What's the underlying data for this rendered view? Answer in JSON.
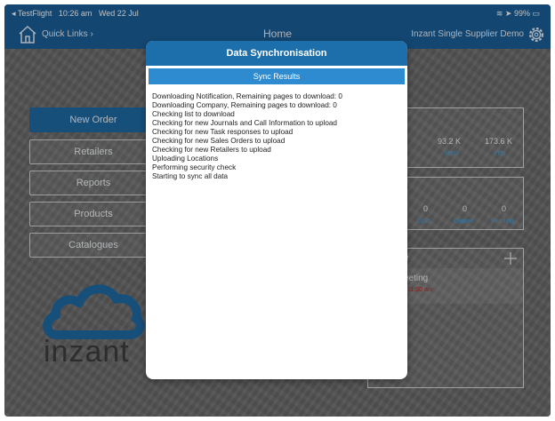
{
  "status_bar": {
    "carrier": "◂ TestFlight",
    "time": "10:26 am",
    "date": "Wed 22 Jul",
    "battery": "99%"
  },
  "nav": {
    "quick_links": "Quick Links ›",
    "title": "Home",
    "company": "Inzant Single Supplier Demo"
  },
  "menu": [
    {
      "label": "New Order",
      "active": true
    },
    {
      "label": "Retailers",
      "active": false
    },
    {
      "label": "Reports",
      "active": false
    },
    {
      "label": "Products",
      "active": false
    },
    {
      "label": "Catalogues",
      "active": false
    }
  ],
  "logo_text": "inzant",
  "stats": {
    "mtd_value": "93.2 K",
    "mtd_label": "MTD",
    "ytd_value": "173.6 K",
    "ytd_label": "YTD"
  },
  "orders": [
    {
      "count": "0",
      "label": "Draft"
    },
    {
      "count": "0",
      "label": "Quotes"
    },
    {
      "count": "0",
      "label": "Pending"
    }
  ],
  "schedule": {
    "title_fragment": "e",
    "item_title": "eeting",
    "item_time": "11:00 am"
  },
  "modal": {
    "title": "Data Synchronisation",
    "subtitle": "Sync Results",
    "log": [
      "Downloading Notification, Remaining pages to download: 0",
      "Downloading Company, Remaining pages to download: 0",
      "Checking list to download",
      "Checking for new Journals and Call Information to upload",
      "Checking for new Task responses to upload",
      "Checking for new Sales Orders to upload",
      "Checking for new Retailers to upload",
      "Uploading Locations",
      "Performing security check",
      "Starting to sync all data"
    ]
  },
  "colors": {
    "primary": "#1a5f99",
    "accent": "#2e8bd0",
    "alert": "#cc2222"
  }
}
